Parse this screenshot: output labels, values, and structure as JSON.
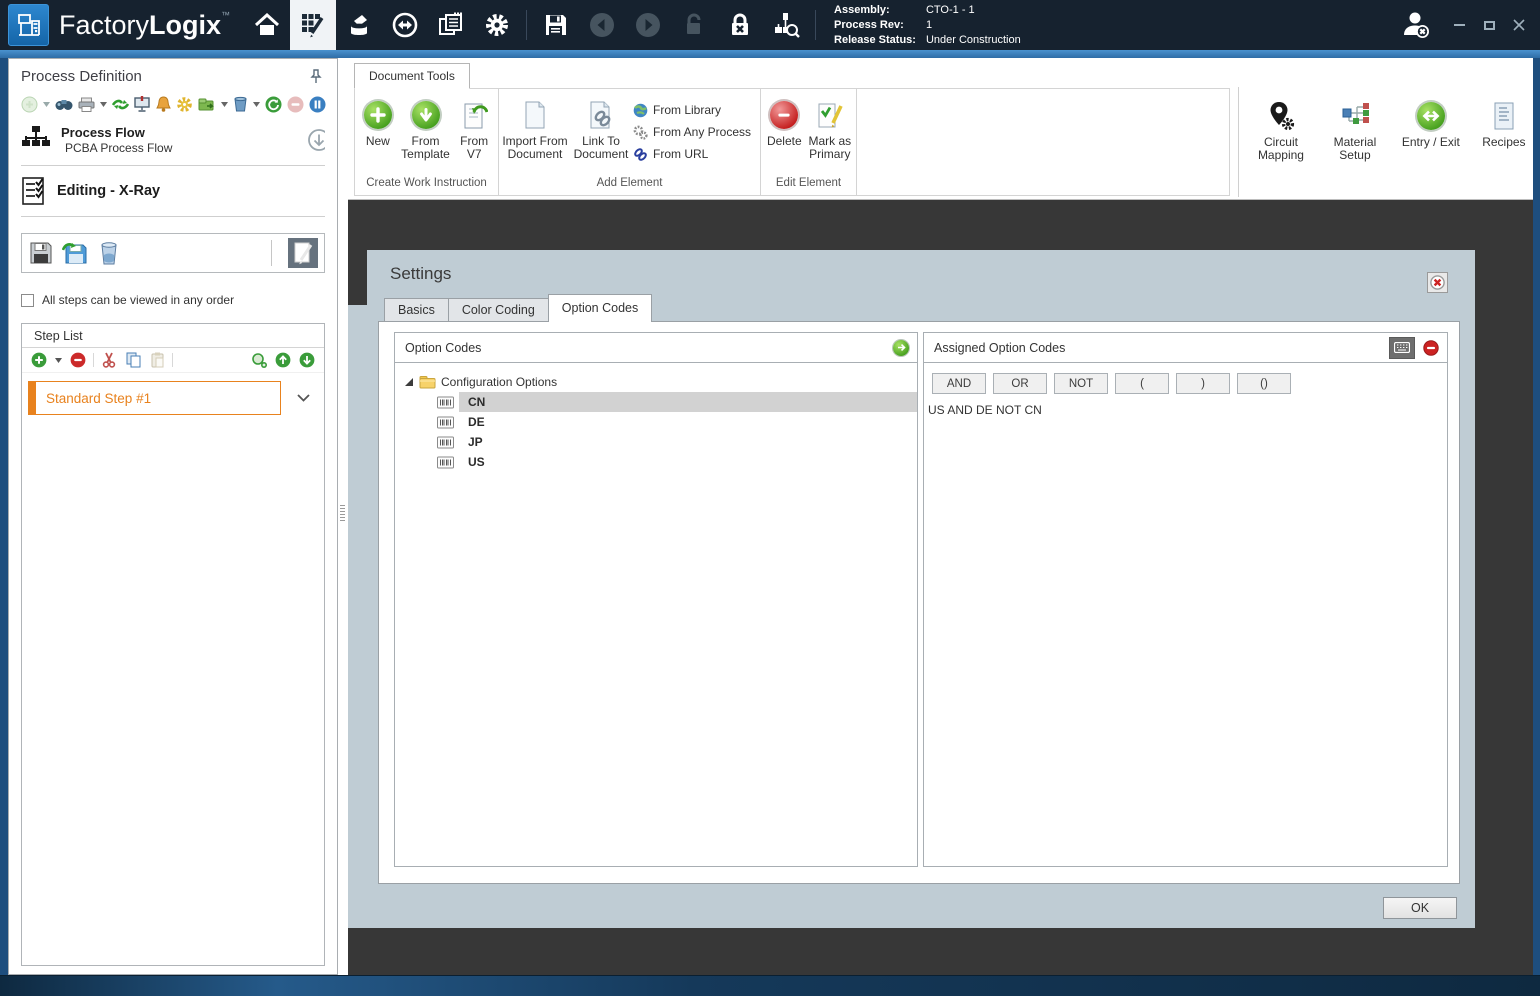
{
  "titlebar": {
    "brand_light": "Factory",
    "brand_bold": "Logix",
    "trademark": "™",
    "assembly_label": "Assembly:",
    "assembly_value": "CTO-1 - 1",
    "process_rev_label": "Process Rev:",
    "process_rev_value": "1",
    "release_status_label": "Release Status:",
    "release_status_value": "Under Construction"
  },
  "left_panel": {
    "title": "Process Definition",
    "process_flow_title": "Process Flow",
    "process_flow_subtitle": "PCBA Process Flow",
    "editing_label": "Editing - X-Ray",
    "order_checkbox_label": "All steps can be viewed in any order",
    "step_list_title": "Step List",
    "steps": [
      {
        "label": "Standard Step #1"
      }
    ]
  },
  "ribbon": {
    "tab_label": "Document Tools",
    "create_group": {
      "label": "Create Work Instruction",
      "new_label": "New",
      "from_template_label": "From Template",
      "from_v7_label": "From V7"
    },
    "add_group": {
      "label": "Add Element",
      "import_label": "Import From Document",
      "link_label": "Link To Document",
      "from_library_label": "From Library",
      "from_any_process_label": "From Any Process",
      "from_url_label": "From URL"
    },
    "edit_group": {
      "label": "Edit Element",
      "delete_label": "Delete",
      "mark_primary_label": "Mark as Primary"
    },
    "right_group": {
      "circuit_mapping_label": "Circuit Mapping",
      "material_setup_label": "Material Setup",
      "entry_exit_label": "Entry / Exit",
      "recipes_label": "Recipes"
    }
  },
  "settings_dialog": {
    "title": "Settings",
    "tabs": [
      {
        "label": "Basics"
      },
      {
        "label": "Color Coding"
      },
      {
        "label": "Option Codes"
      }
    ],
    "active_tab": "Option Codes",
    "option_codes_panel": {
      "title": "Option Codes",
      "root_label": "Configuration Options",
      "codes": [
        {
          "label": "CN"
        },
        {
          "label": "DE"
        },
        {
          "label": "JP"
        },
        {
          "label": "US"
        }
      ],
      "selected_code": "CN"
    },
    "assigned_panel": {
      "title": "Assigned Option Codes",
      "operators": [
        {
          "label": "AND"
        },
        {
          "label": "OR"
        },
        {
          "label": "NOT"
        },
        {
          "label": "("
        },
        {
          "label": ")"
        },
        {
          "label": "()"
        }
      ],
      "expression": "US AND DE NOT CN"
    },
    "ok_label": "OK"
  },
  "colors": {
    "titlebar_bg": "#16222f",
    "accent_blue": "#3a80bd",
    "frame_blue": "#1e4e7e",
    "content_dark": "#373737",
    "dialog_bg": "#bfccd4",
    "step_orange": "#e8821e",
    "selected_row_gray": "#d2d2d2"
  }
}
